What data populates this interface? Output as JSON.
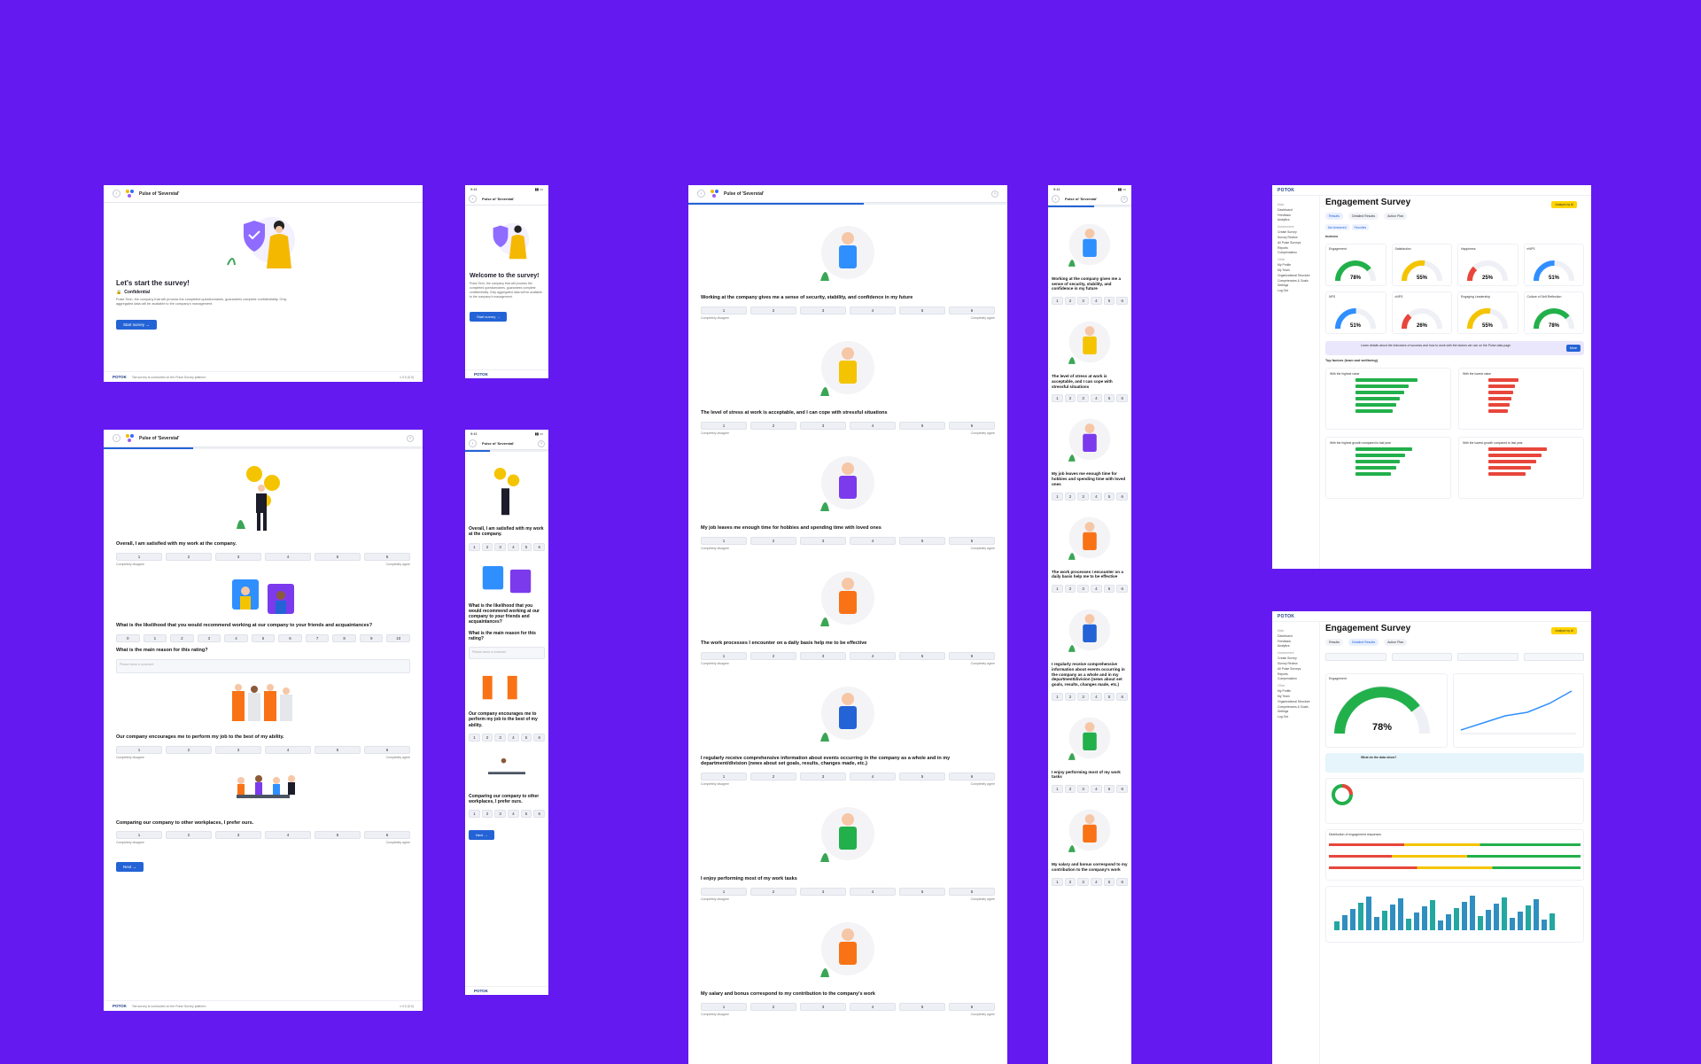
{
  "survey": {
    "title": "Pulse of 'Severstal'",
    "version": "v 0.0 (0.0)",
    "footer_text": "Tab survey is conducted on the Pulse Survey platform",
    "brand": "POTOK",
    "status_time": "9:41"
  },
  "intro": {
    "heading_desktop": "Let's start the survey!",
    "heading_mobile": "Welcome to the survey!",
    "confidential": "Confidential",
    "body": "Pulse Tech, the company that will process the completed questionnaires, guarantees complete confidentiality. Only aggregated data will be available to the company's management.",
    "start_button": "Start survey"
  },
  "scale": {
    "left_label": "Completely disagree",
    "right_label": "Completely agree",
    "six": [
      "1",
      "2",
      "3",
      "4",
      "5",
      "6"
    ],
    "eleven": [
      "0",
      "1",
      "2",
      "3",
      "4",
      "5",
      "6",
      "7",
      "8",
      "9",
      "10"
    ]
  },
  "questions_a": {
    "q1": "Overall, I am satisfied with my work at the company.",
    "q2": "What is the likelihood that you would recommend working at our company to your friends and acquaintances?",
    "q2b": "What is the main reason for this rating?",
    "q2b_placeholder": "Please leave a comment",
    "q3": "Our company encourages me to perform my job to the best of my ability.",
    "q4": "Comparing our company to other workplaces, I prefer ours.",
    "next_button": "Next"
  },
  "questions_b": {
    "q1": "Working at the company gives me a sense of security, stability, and confidence in my future",
    "q2": "The level of stress at work is acceptable, and I can cope with stressful situations",
    "q3": "My job leaves me enough time for hobbies and spending time with loved ones",
    "q4": "The work processes I encounter on a daily basis help me to be effective",
    "q5": "I regularly receive comprehensive information about events occurring in the company as a whole and in my department/division (news about set goals, results, changes made, etc.)",
    "q6": "I enjoy performing most of my work tasks",
    "q7": "My salary and bonus correspond to my contribution to the company's work"
  },
  "dashboard": {
    "title": "Engagement Survey",
    "upgrade": "Analyze by AI",
    "nav": [
      "Main",
      "Dashboard",
      "Feedback",
      "Analytics",
      "Assessment",
      "Create Survey",
      "Survey Review",
      "All Pulse Surveys",
      "Reports",
      "Compensation",
      "Other",
      "My Profile",
      "My Team",
      "Organizational Structure",
      "Competencies & Goals",
      "Settings",
      "Log Out"
    ],
    "tabs": [
      "Results",
      "Detailed Results",
      "Action Plan"
    ],
    "filter_pills": [
      "Not Answered",
      "Favorites"
    ],
    "indexes_label": "Indexes",
    "gauges": [
      {
        "name": "Engagement",
        "value": "78%",
        "pct": 78,
        "color": "#22b04b"
      },
      {
        "name": "Satisfaction",
        "value": "55%",
        "pct": 55,
        "color": "#f5c400"
      },
      {
        "name": "Happiness",
        "value": "25%",
        "pct": 25,
        "color": "#e8463b"
      },
      {
        "name": "eNPS",
        "value": "51%",
        "pct": 51,
        "color": "#2f8fff"
      },
      {
        "name": "NPS",
        "value": "51%",
        "pct": 51,
        "color": "#2f8fff"
      },
      {
        "name": "cNPS",
        "value": "26%",
        "pct": 26,
        "color": "#e8463b"
      },
      {
        "name": "Engaging Leadership",
        "value": "55%",
        "pct": 55,
        "color": "#f5c400"
      },
      {
        "name": "Culture of Self-Reflection",
        "value": "78%",
        "pct": 78,
        "color": "#22b04b"
      }
    ],
    "banner_text": "Learn details about the indicators of success and how to work with the factors we use on the Pulse data page",
    "banner_cta": "More",
    "factors_title": "Top factors (team and wellbeing)",
    "highest_title": "With the highest value",
    "lowest_title": "With the lowest value",
    "growth_title": "With the highest growth compared to last year",
    "decline_title": "With the lowest growth compared to last year",
    "engagement_label": "Engagement",
    "engagement_value": "78%",
    "data_title": "What do the data show?",
    "distribution_title": "Distribution of engagement responses"
  },
  "colors": {
    "bg": "#6319f0",
    "accent": "#2463d6",
    "green": "#22b04b",
    "red": "#e8463b"
  }
}
